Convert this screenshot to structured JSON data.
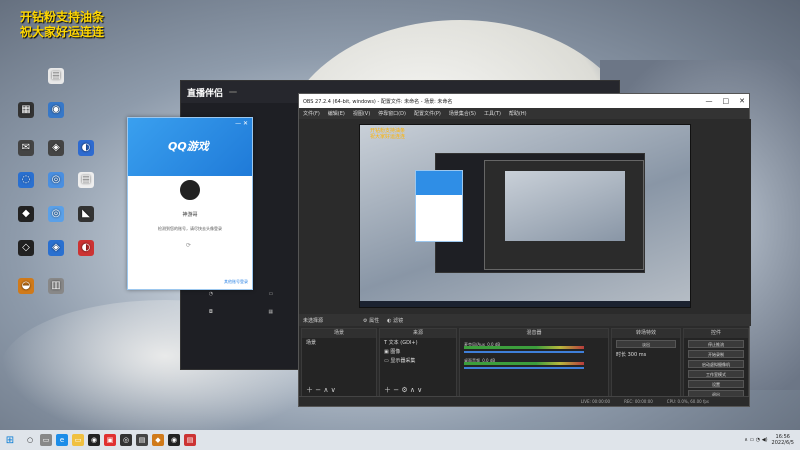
{
  "overlay": {
    "line1": "开钻粉支持油条",
    "line2": "祝大家好运连连"
  },
  "desktop_icons": [
    {
      "label": "",
      "color": "#e8e8e8",
      "glyph": "▤"
    },
    {
      "label": "",
      "color": "#333",
      "glyph": "▦"
    },
    {
      "label": "",
      "color": "#3778c8",
      "glyph": "◉"
    },
    {
      "label": "",
      "color": "#444",
      "glyph": "✉"
    },
    {
      "label": "",
      "color": "#444",
      "glyph": "◈"
    },
    {
      "label": "",
      "color": "#2e6bd0",
      "glyph": "◐"
    },
    {
      "label": "",
      "color": "#2a70d0",
      "glyph": "◌"
    },
    {
      "label": "",
      "color": "#4a8fe0",
      "glyph": "◎"
    },
    {
      "label": "",
      "color": "#eee",
      "glyph": "▤"
    },
    {
      "label": "",
      "color": "#222",
      "glyph": "◆"
    },
    {
      "label": "",
      "color": "#5aa0e8",
      "glyph": "◎"
    },
    {
      "label": "",
      "color": "#333",
      "glyph": "◣"
    },
    {
      "label": "",
      "color": "#222",
      "glyph": "◇"
    },
    {
      "label": "",
      "color": "#2a70d0",
      "glyph": "◈"
    },
    {
      "label": "",
      "color": "#c33",
      "glyph": "◐"
    },
    {
      "label": "",
      "color": "#d07a1a",
      "glyph": "◒"
    },
    {
      "label": "",
      "color": "#888",
      "glyph": "▥"
    }
  ],
  "live": {
    "logo": "直播伴侣",
    "badge": "",
    "tabs": [
      "",
      "",
      ""
    ],
    "bottom": ""
  },
  "qq": {
    "title": "QQ游戏",
    "subtitle": "",
    "name": "神游哥",
    "tip": "检测到您的账号，请尽快去头像登录",
    "link": "其他账号登录"
  },
  "obs": {
    "title": "OBS 27.2.4 (64-bit, windows) - 配置文件: 未命名 - 场景: 未命名",
    "menu": [
      "文件(F)",
      "编辑(E)",
      "视图(V)",
      "停靠窗口(D)",
      "配置文件(P)",
      "场景集合(S)",
      "工具(T)",
      "帮助(H)"
    ],
    "status_label": "未选择源",
    "props_button": "属性",
    "filter_button": "滤镜",
    "scenes_header": "场景",
    "scenes": [
      "场景"
    ],
    "sources_header": "来源",
    "sources": [
      "文本 (GDI+)",
      "图像",
      "显示器采集"
    ],
    "mixer_header": "混音器",
    "mixer": [
      {
        "name": "麦克风/Aux",
        "level": "0.0 dB"
      },
      {
        "name": "桌面音频",
        "level": "0.0 dB"
      }
    ],
    "transitions_header": "转场特效",
    "transition": "淡出",
    "duration_label": "时长",
    "duration": "300 ms",
    "controls_header": "控件",
    "controls": [
      "停止推流",
      "开始录制",
      "启动虚拟摄像机",
      "工作室模式",
      "设置",
      "退出"
    ],
    "status": [
      "LIVE: 00:00:00",
      "REC: 00:00:00",
      "CPU: 0.0%, 60.00 fps"
    ]
  },
  "taskbar": {
    "time": "16:56",
    "date": "2022/6/5"
  }
}
